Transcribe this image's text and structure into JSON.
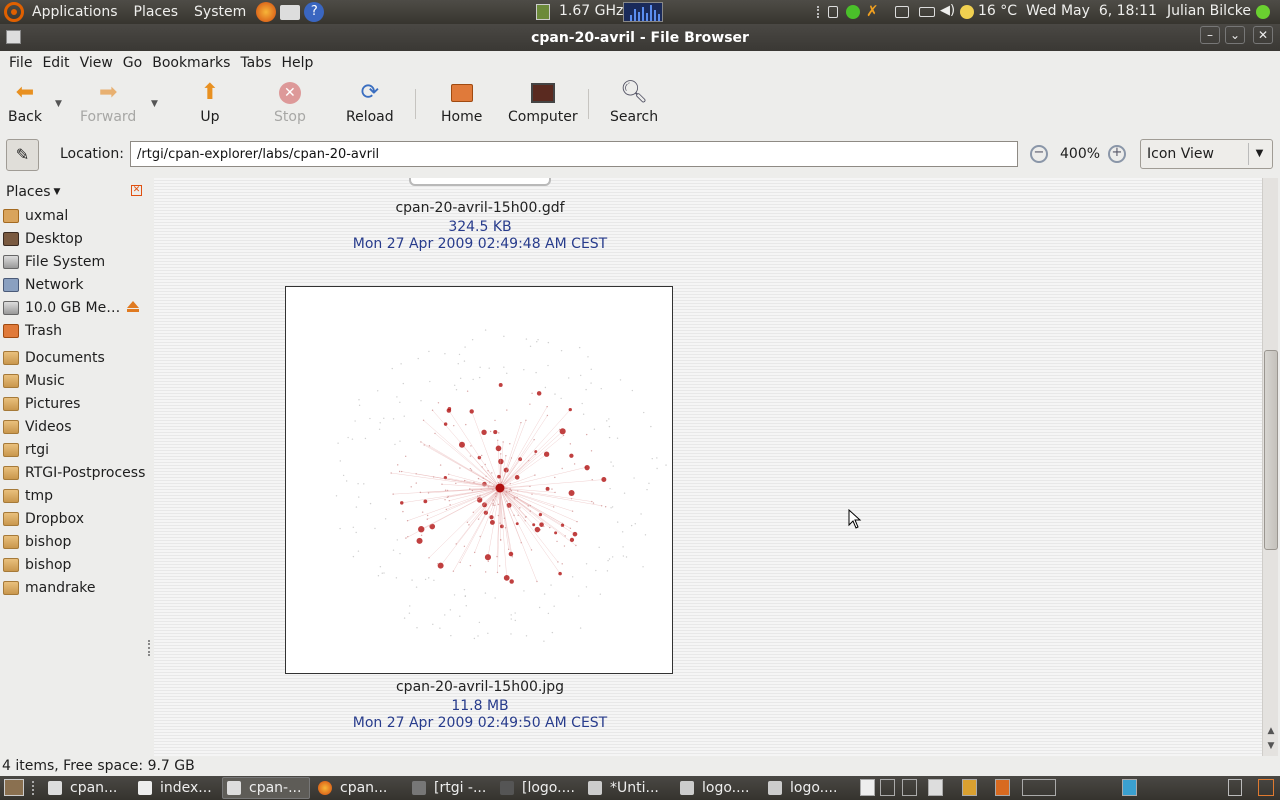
{
  "top_panel": {
    "menus": [
      "Applications",
      "Places",
      "System"
    ],
    "cpu_freq": "1.67 GHz",
    "weather": "16 °C",
    "clock": "Wed May  6, 18:11",
    "user": "Julian Bilcke"
  },
  "window": {
    "title": "cpan-20-avril - File Browser"
  },
  "menu_bar": [
    "File",
    "Edit",
    "View",
    "Go",
    "Bookmarks",
    "Tabs",
    "Help"
  ],
  "toolbar": {
    "back": "Back",
    "forward": "Forward",
    "up": "Up",
    "stop": "Stop",
    "reload": "Reload",
    "home": "Home",
    "computer": "Computer",
    "search": "Search"
  },
  "location": {
    "label": "Location:",
    "path": "/rtgi/cpan-explorer/labs/cpan-20-avril",
    "zoom": "400%",
    "view_mode": "Icon View"
  },
  "sidebar": {
    "title": "Places",
    "items": [
      {
        "label": "uxmal",
        "icon": "home-icon"
      },
      {
        "label": "Desktop",
        "icon": "desktop-icon"
      },
      {
        "label": "File System",
        "icon": "drive-icon"
      },
      {
        "label": "Network",
        "icon": "network-icon"
      },
      {
        "label": "10.0 GB Me…",
        "icon": "drive-icon"
      },
      {
        "label": "Trash",
        "icon": "trash-icon"
      }
    ],
    "bookmarks": [
      "Documents",
      "Music",
      "Pictures",
      "Videos",
      "rtgi",
      "RTGI-Postprocess",
      "tmp",
      "Dropbox",
      "bishop",
      "bishop",
      "mandrake"
    ]
  },
  "files": [
    {
      "name": "cpan-20-avril-15h00.gdf",
      "size": "324.5 KB",
      "date": "Mon 27 Apr 2009 02:49:48 AM CEST"
    },
    {
      "name": "cpan-20-avril-15h00.jpg",
      "size": "11.8 MB",
      "date": "Mon 27 Apr 2009 02:49:50 AM CEST"
    }
  ],
  "status": "4 items, Free space: 9.7 GB",
  "taskbar": [
    "cpan...",
    "index...",
    "cpan-...",
    "cpan...",
    "[rtgi -...",
    "[logo....",
    "*Unti...",
    "logo....",
    "logo...."
  ],
  "colors": {
    "accent_orange": "#e06000",
    "meta_blue": "#283c8c",
    "graph_red": "#b01010"
  }
}
